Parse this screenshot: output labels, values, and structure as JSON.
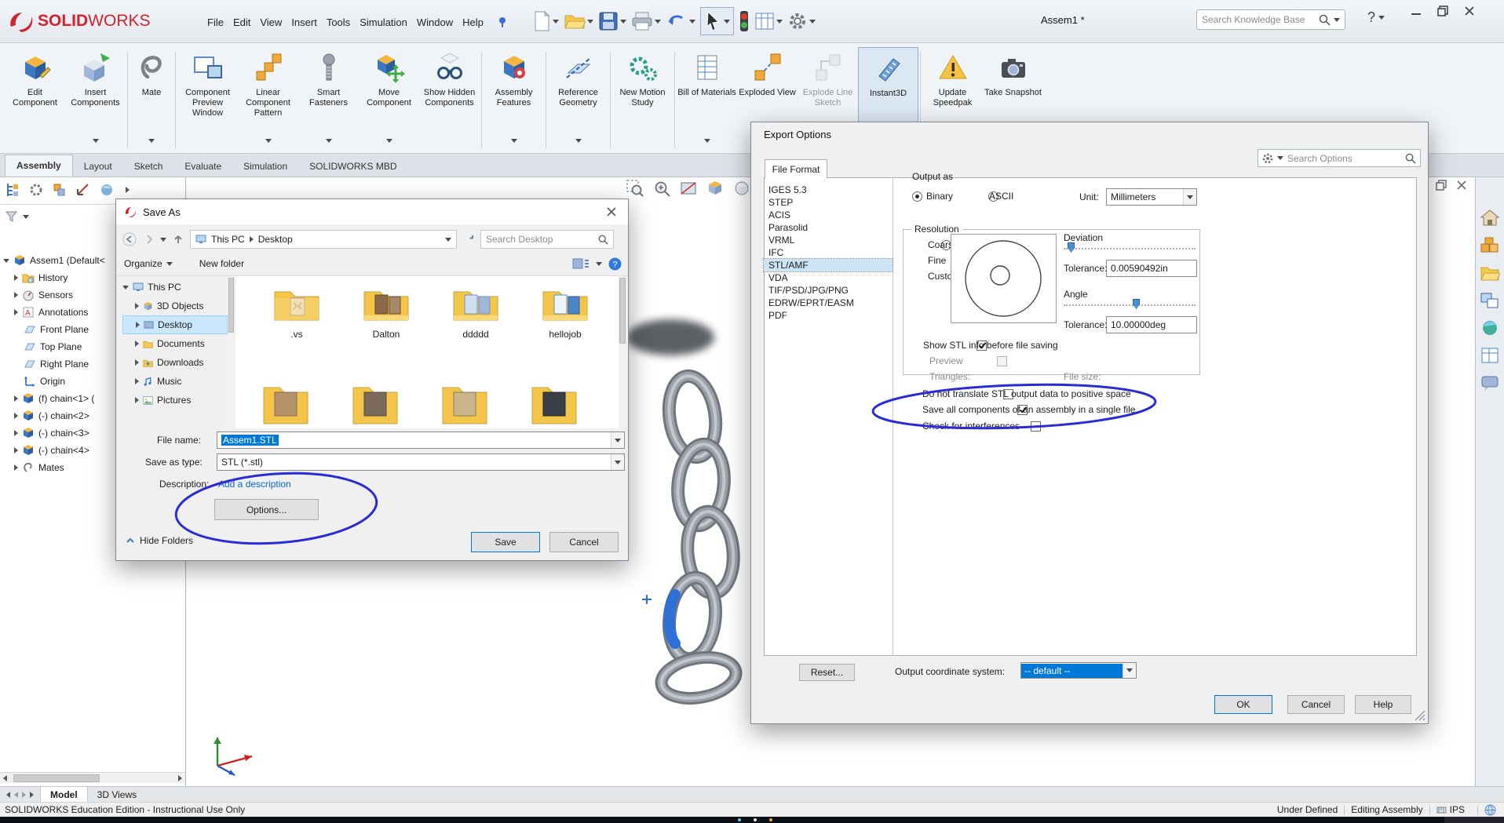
{
  "colors": {
    "annotation_blue": "#2b2bd6",
    "selection_blue": "#0078d7",
    "brand_red": "#d2232a"
  },
  "titlebar": {
    "brand": {
      "ds": "DS",
      "solid": "SOLID",
      "works": "WORKS"
    },
    "menus": [
      "File",
      "Edit",
      "View",
      "Insert",
      "Tools",
      "Simulation",
      "Window",
      "Help"
    ],
    "document_title": "Assem1 *",
    "search_placeholder": "Search Knowledge Base",
    "help_label": "?"
  },
  "ribbon": {
    "items": [
      {
        "label": "Edit Component"
      },
      {
        "label": "Insert Components"
      },
      {
        "label": "Mate"
      },
      {
        "label": "Component Preview Window"
      },
      {
        "label": "Linear Component Pattern"
      },
      {
        "label": "Smart Fasteners"
      },
      {
        "label": "Move Component"
      },
      {
        "label": "Show Hidden Components"
      },
      {
        "label": "Assembly Features"
      },
      {
        "label": "Reference Geometry"
      },
      {
        "label": "New Motion Study"
      },
      {
        "label": "Bill of Materials"
      },
      {
        "label": "Exploded View"
      },
      {
        "label": "Explode Line Sketch"
      },
      {
        "label": "Instant3D"
      },
      {
        "label": "Update Speedpak"
      },
      {
        "label": "Take Snapshot"
      }
    ],
    "tabs": [
      "Assembly",
      "Layout",
      "Sketch",
      "Evaluate",
      "Simulation",
      "SOLIDWORKS MBD"
    ]
  },
  "tree": {
    "items": [
      {
        "label": "Assem1 (Default<"
      },
      {
        "label": "History"
      },
      {
        "label": "Sensors"
      },
      {
        "label": "Annotations"
      },
      {
        "label": "Front Plane"
      },
      {
        "label": "Top Plane"
      },
      {
        "label": "Right Plane"
      },
      {
        "label": "Origin"
      },
      {
        "label": "(f) chain<1> ("
      },
      {
        "label": "(-) chain<2>"
      },
      {
        "label": "(-) chain<3>"
      },
      {
        "label": "(-) chain<4>"
      },
      {
        "label": "Mates"
      }
    ]
  },
  "save_dialog": {
    "title": "Save As",
    "breadcrumb": [
      "This PC",
      "Desktop"
    ],
    "search_placeholder": "Search Desktop",
    "organize": "Organize",
    "new_folder": "New folder",
    "nav": [
      "This PC",
      "3D Objects",
      "Desktop",
      "Documents",
      "Downloads",
      "Music",
      "Pictures"
    ],
    "folders": [
      ".vs",
      "Dalton",
      "ddddd",
      "hellojob"
    ],
    "file_name_label": "File name:",
    "file_name_value": "Assem1.STL",
    "save_type_label": "Save as type:",
    "save_type_value": "STL (*.stl)",
    "description_label": "Description:",
    "description_link": "Add a description",
    "options_button": "Options...",
    "hide_folders": "Hide Folders",
    "save": "Save",
    "cancel": "Cancel"
  },
  "export_dialog": {
    "title": "Export Options",
    "tab": "File Format",
    "search_placeholder": "Search Options",
    "formats": [
      "IGES 5.3",
      "STEP",
      "ACIS",
      "Parasolid",
      "VRML",
      "IFC",
      "STL/AMF",
      "VDA",
      "TIF/PSD/JPG/PNG",
      "EDRW/EPRT/EASM",
      "PDF"
    ],
    "selected_format": "STL/AMF",
    "output_as": "Output as",
    "binary": "Binary",
    "ascii": "ASCII",
    "unit_label": "Unit:",
    "unit_value": "Millimeters",
    "resolution": "Resolution",
    "coarse": "Coarse",
    "fine": "Fine",
    "custom": "Custom",
    "deviation": "Deviation",
    "tolerance_label": "Tolerance:",
    "deviation_tolerance": "0.00590492in",
    "angle": "Angle",
    "angle_tolerance": "10.00000deg",
    "show_stl": "Show STL info before file saving",
    "preview": "Preview",
    "triangles": "Triangles:",
    "file_size": "File size:",
    "checkboxes": [
      "Do not translate STL output data to positive space",
      "Save all components of an assembly in a single file",
      "Check for interferences"
    ],
    "checkbox_states": [
      false,
      true,
      false
    ],
    "reset": "Reset...",
    "coord_label": "Output coordinate system:",
    "coord_value": "-- default --",
    "ok": "OK",
    "cancel": "Cancel",
    "help": "Help"
  },
  "bottom": {
    "tabs": [
      "Model",
      "3D Views"
    ]
  },
  "status": {
    "left": "SOLIDWORKS Education Edition - Instructional Use Only",
    "under_defined": "Under Defined",
    "editing": "Editing Assembly",
    "units": "IPS"
  }
}
